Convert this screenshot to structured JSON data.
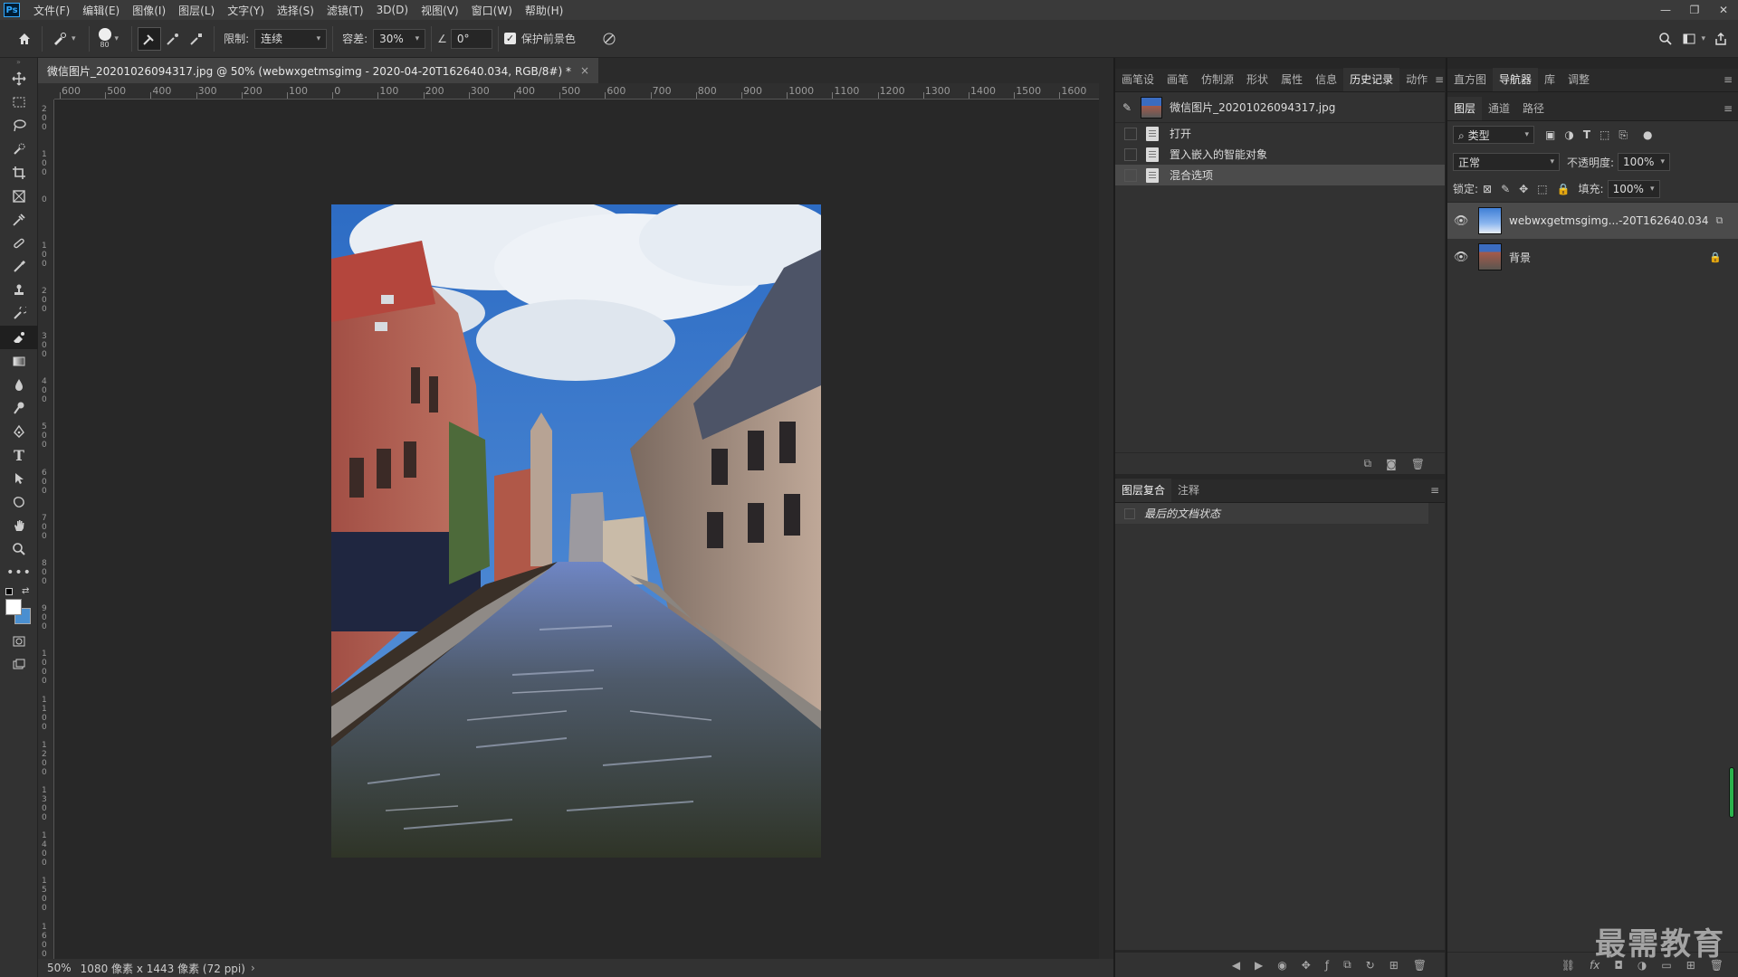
{
  "menu": {
    "logo": "Ps",
    "items": [
      "文件(F)",
      "编辑(E)",
      "图像(I)",
      "图层(L)",
      "文字(Y)",
      "选择(S)",
      "滤镜(T)",
      "3D(D)",
      "视图(V)",
      "窗口(W)",
      "帮助(H)"
    ],
    "window_controls": {
      "minimize": "—",
      "restore": "❐",
      "close": "✕"
    }
  },
  "options": {
    "brush_size": "80",
    "limit_label": "限制:",
    "limit_value": "连续",
    "tolerance_label": "容差:",
    "tolerance_value": "30%",
    "angle_value": "0°",
    "protect_label": "保护前景色",
    "protect_checked": "✓"
  },
  "document": {
    "tab_title": "微信图片_20201026094317.jpg @ 50% (webwxgetmsgimg - 2020-04-20T162640.034, RGB/8#) *",
    "close": "×",
    "ruler_top": [
      "600",
      "500",
      "400",
      "300",
      "200",
      "100",
      "0",
      "100",
      "200",
      "300",
      "400",
      "500",
      "600",
      "700",
      "800",
      "900",
      "1000",
      "1100",
      "1200",
      "1300",
      "1400",
      "1500",
      "1600"
    ],
    "ruler_left": [
      "2\n0\n0",
      "1\n0\n0",
      "0",
      "1\n0\n0",
      "2\n0\n0",
      "3\n0\n0",
      "4\n0\n0",
      "5\n0\n0",
      "6\n0\n0",
      "7\n0\n0",
      "8\n0\n0",
      "9\n0\n0",
      "1\n0\n0\n0",
      "1\n1\n0\n0",
      "1\n2\n0\n0",
      "1\n3\n0\n0",
      "1\n4\n0\n0",
      "1\n5\n0\n0",
      "1\n6\n0\n0"
    ]
  },
  "status": {
    "zoom": "50%",
    "info": "1080 像素 x 1443 像素 (72 ppi)",
    "arrow": "›"
  },
  "history_panel": {
    "tabs": [
      "画笔设",
      "画笔",
      "仿制源",
      "形状",
      "属性",
      "信息",
      "历史记录",
      "动作"
    ],
    "active_tab": 6,
    "snapshot": "微信图片_20201026094317.jpg",
    "items": [
      "打开",
      "置入嵌入的智能对象",
      "混合选项"
    ]
  },
  "comps_panel": {
    "tabs": [
      "图层复合",
      "注释"
    ],
    "item": "最后的文档状态"
  },
  "top_right_tabs": [
    "直方图",
    "导航器",
    "库",
    "调整"
  ],
  "top_right_active": 1,
  "layers_panel": {
    "tabs": [
      "图层",
      "通道",
      "路径"
    ],
    "filter_label": "类型",
    "blend_mode": "正常",
    "opacity_label": "不透明度:",
    "opacity_value": "100%",
    "lock_label": "锁定:",
    "fill_label": "填充:",
    "fill_value": "100%",
    "layers": [
      {
        "name": "webwxgetmsgimg...-20T162640.034"
      },
      {
        "name": "背景"
      }
    ]
  },
  "watermark": "最需教育",
  "colors": {
    "accent": "#31a8ff",
    "panel_bg": "#323232",
    "canvas_bg": "#282828"
  }
}
